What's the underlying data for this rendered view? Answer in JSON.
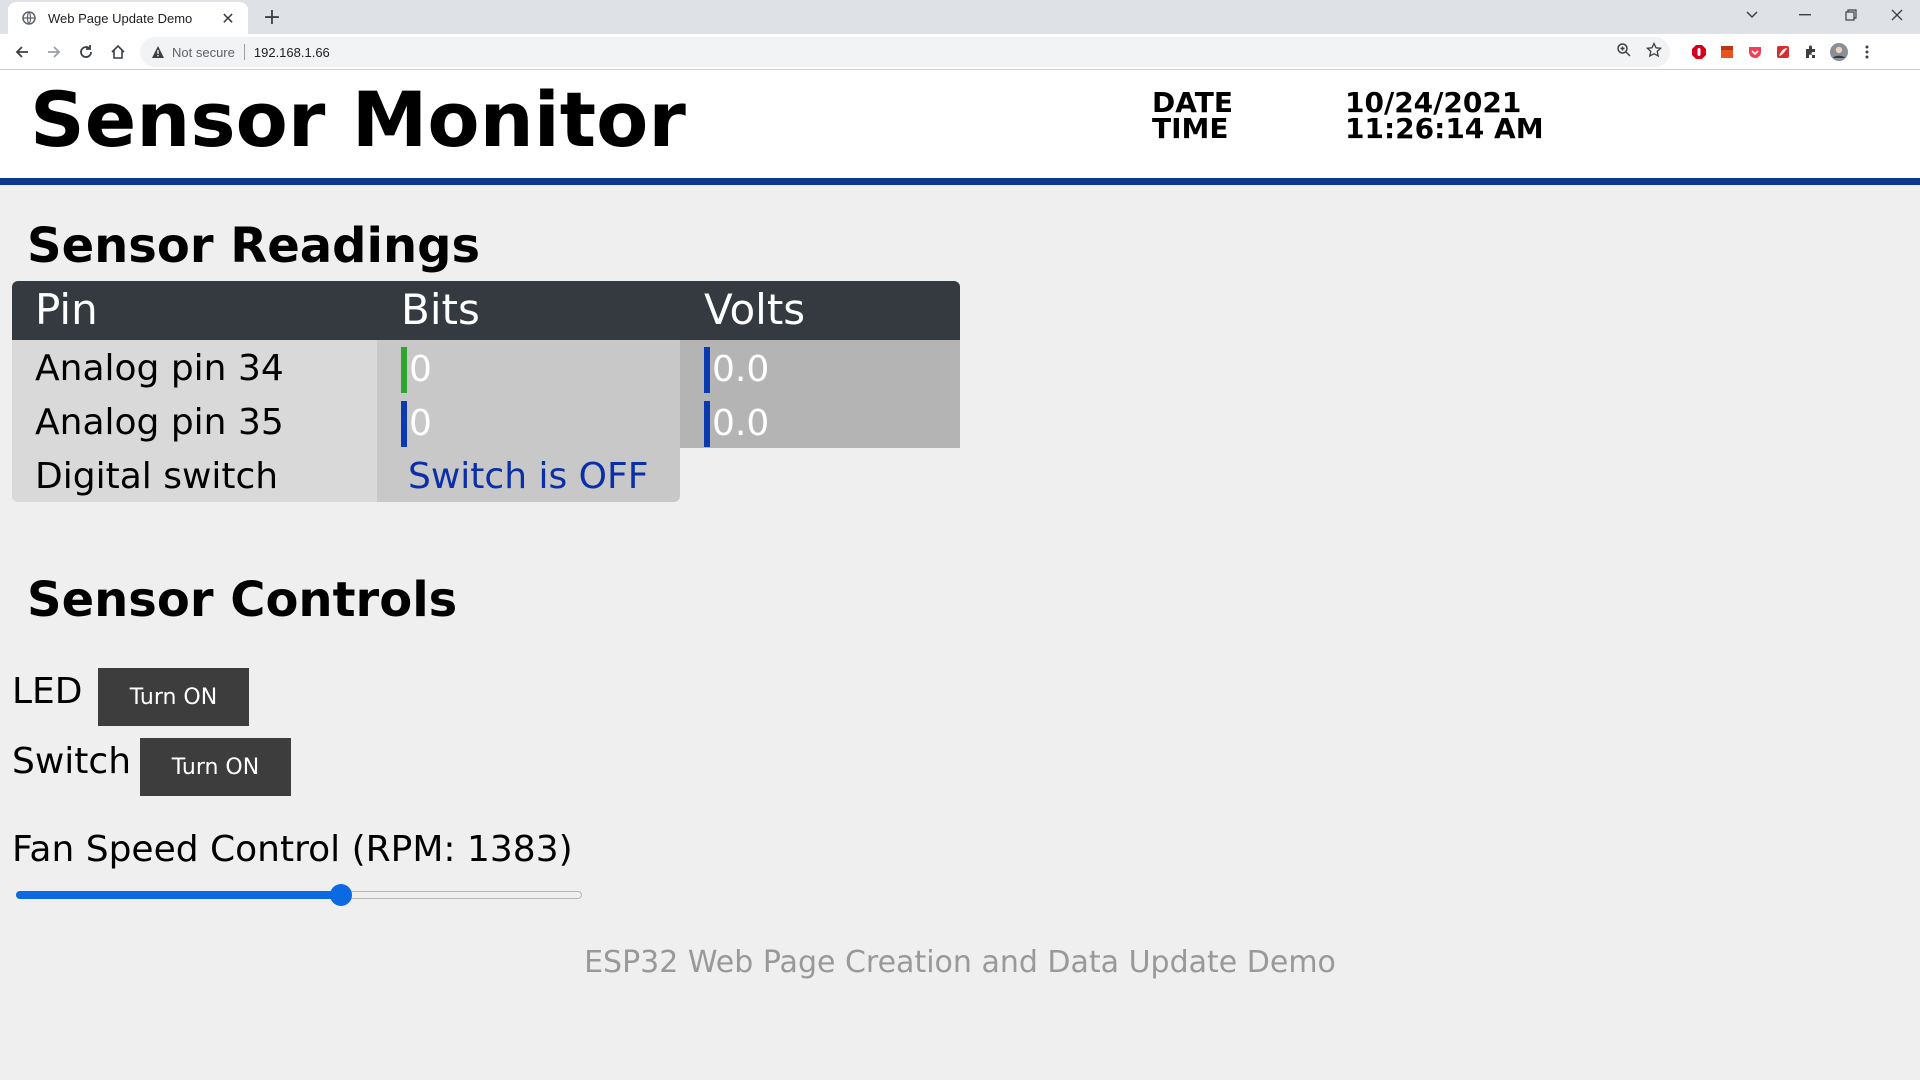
{
  "browser": {
    "tab_title": "Web Page Update Demo",
    "tab_close": "✕",
    "new_tab": "+",
    "security_label": "Not secure",
    "url": "192.168.1.66",
    "icons": [
      "globe-icon",
      "back-icon",
      "forward-icon",
      "reload-icon",
      "home-icon",
      "warning-icon",
      "zoom-icon",
      "star-icon",
      "extension-icon",
      "profile-icon",
      "menu-icon"
    ]
  },
  "header": {
    "title": "Sensor Monitor",
    "date_label": "DATE",
    "time_label": "TIME",
    "date_value": "10/24/2021",
    "time_value": "11:26:14 AM",
    "accent_color": "#0b3a8c"
  },
  "readings": {
    "title": "Sensor Readings",
    "columns": [
      "Pin",
      "Bits",
      "Volts"
    ],
    "rows": [
      {
        "label": "Analog pin 34",
        "bits": "0",
        "volts": "0.0",
        "bits_bar_color": "#2ea52e",
        "volts_bar_color": "#0b3ab0"
      },
      {
        "label": "Analog pin 35",
        "bits": "0",
        "volts": "0.0",
        "bits_bar_color": "#0b3ab0",
        "volts_bar_color": "#0b3ab0"
      },
      {
        "label": "Digital switch",
        "status": "Switch is OFF"
      }
    ]
  },
  "controls": {
    "title": "Sensor Controls",
    "led_label": "LED",
    "led_button": "Turn ON",
    "switch_label": "Switch",
    "switch_button": "Turn ON",
    "fan_label": "Fan Speed Control (RPM: 1383)",
    "fan_slider_fraction": 0.575
  },
  "footer": {
    "text": "ESP32 Web Page Creation and Data Update Demo"
  }
}
